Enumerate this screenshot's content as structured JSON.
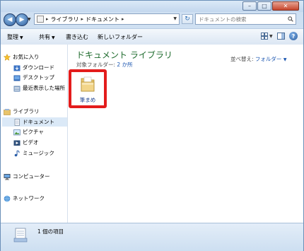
{
  "address": {
    "path": [
      "ライブラリ",
      "ドキュメント"
    ],
    "search_placeholder": "ドキュメントの検索"
  },
  "toolbar": {
    "organize": "整理",
    "share": "共有",
    "burn": "書き込む",
    "new_folder": "新しいフォルダー"
  },
  "sidebar": {
    "favorites": "お気に入り",
    "favorites_items": [
      "ダウンロード",
      "デスクトップ",
      "最近表示した場所"
    ],
    "libraries": "ライブラリ",
    "library_items": [
      "ドキュメント",
      "ピクチャ",
      "ビデオ",
      "ミュージック"
    ],
    "computer": "コンピューター",
    "network": "ネットワーク"
  },
  "content": {
    "title": "ドキュメント ライブラリ",
    "subtitle_prefix": "対象フォルダー:",
    "subtitle_link": "2 か所",
    "arrange_label": "並べ替え:",
    "arrange_value": "フォルダー",
    "folder_name": "筆まめ"
  },
  "status": {
    "item_count": "1 個の項目"
  },
  "colors": {
    "highlight_border": "#e31c1c",
    "library_title": "#1e6b2d",
    "link": "#1a55b0"
  }
}
